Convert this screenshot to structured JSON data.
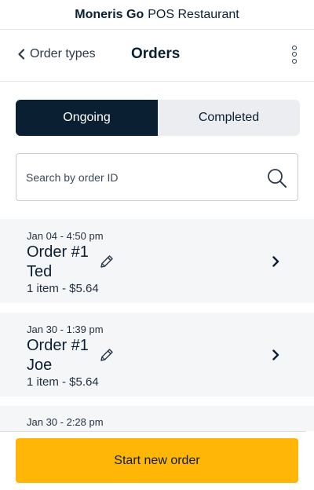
{
  "app": {
    "brand_bold": "Moneris Go",
    "brand_rest": "POS Restaurant"
  },
  "nav": {
    "back_label": "Order types",
    "title": "Orders"
  },
  "tabs": [
    {
      "label": "Ongoing",
      "active": true
    },
    {
      "label": "Completed",
      "active": false
    }
  ],
  "search": {
    "placeholder": "Search by order ID",
    "value": ""
  },
  "orders": [
    {
      "datetime": "Jan 04 - 4:50 pm",
      "order": "Order #1",
      "customer": "Ted",
      "summary": "1  item  - $5.64"
    },
    {
      "datetime": "Jan 30 - 1:39 pm",
      "order": "Order #1",
      "customer": "Joe",
      "summary": "1  item  - $5.64"
    },
    {
      "datetime": "Jan 30 - 2:28 pm"
    }
  ],
  "footer": {
    "start_label": "Start new order"
  },
  "colors": {
    "navy": "#0b1f33",
    "accent_yellow": "#ffb607",
    "card_bg": "#f5f6f8"
  }
}
